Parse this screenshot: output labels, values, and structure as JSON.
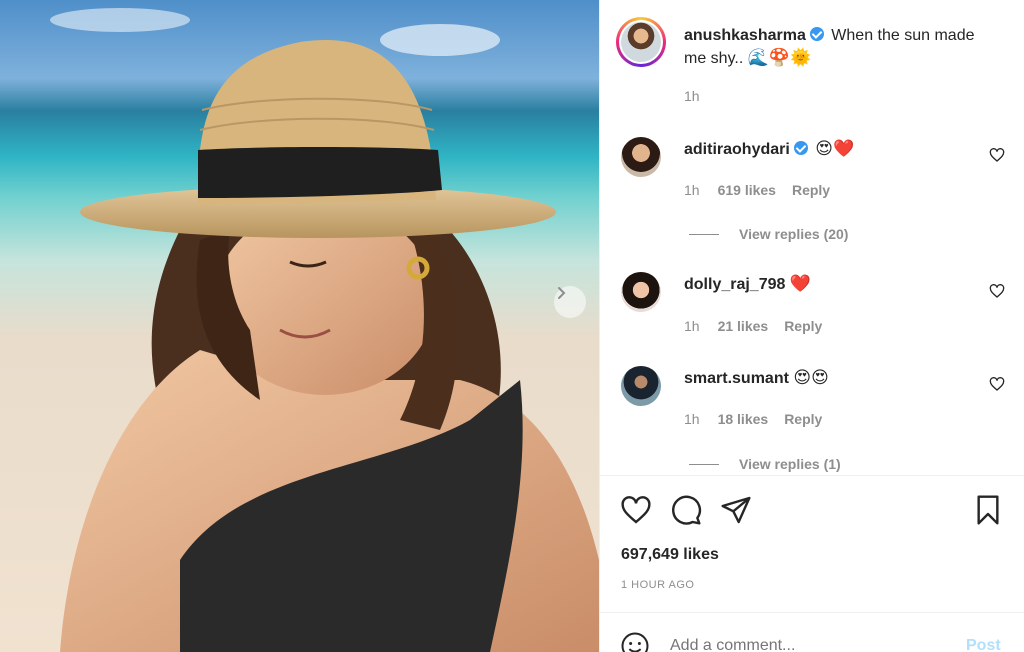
{
  "post": {
    "author": "anushkasharma",
    "caption": "When the sun made me shy..",
    "caption_emoji": "🌊🍄🌞",
    "age": "1h"
  },
  "comments": [
    {
      "user": "aditiraohydari",
      "verified": true,
      "text": "😍❤️",
      "age": "1h",
      "likes": "619 likes",
      "reply": "Reply",
      "view_replies": "View replies (20)"
    },
    {
      "user": "dolly_raj_798",
      "verified": false,
      "text": "❤️",
      "age": "1h",
      "likes": "21 likes",
      "reply": "Reply",
      "view_replies": ""
    },
    {
      "user": "smart.sumant",
      "verified": false,
      "text": "😍😍",
      "age": "1h",
      "likes": "18 likes",
      "reply": "Reply",
      "view_replies": "View replies (1)"
    }
  ],
  "stats": {
    "likes": "697,649 likes",
    "time_ago": "1 HOUR AGO"
  },
  "composer": {
    "placeholder": "Add a comment...",
    "post_label": "Post"
  },
  "icons": {
    "like": "heart-icon",
    "comment": "comment-icon",
    "share": "share-icon",
    "save": "bookmark-icon",
    "emoji": "smiley-icon",
    "next": "chevron-right-icon"
  },
  "colors": {
    "verified": "#3897f0",
    "muted": "#8e8e8e",
    "post_button": "#b2dffc",
    "heart": "#ed4956"
  }
}
